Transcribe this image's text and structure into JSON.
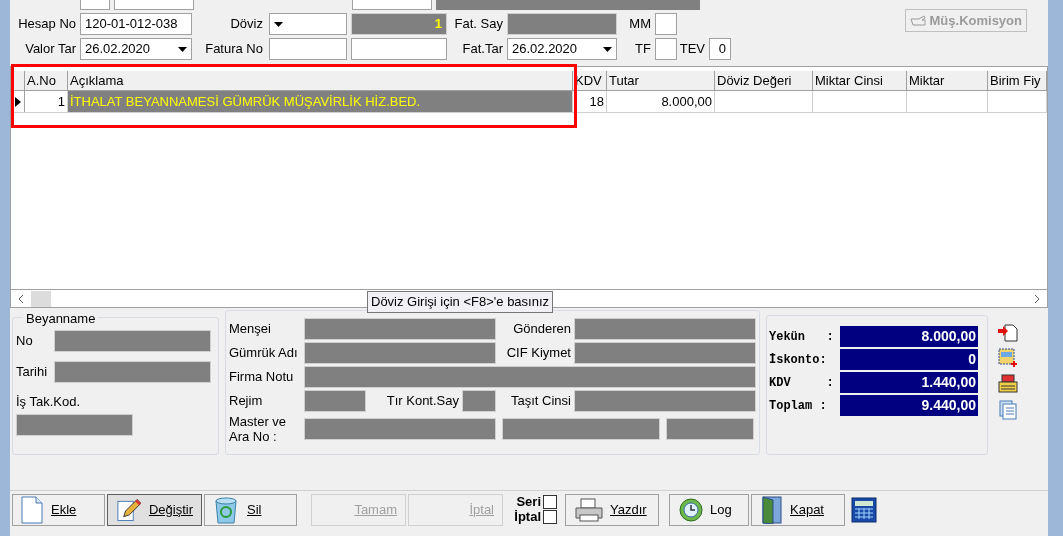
{
  "header": {
    "hesap_no": {
      "label": "Hesap No",
      "value": "120-01-012-038"
    },
    "doviz": {
      "label": "Döviz"
    },
    "doviz_rate": "1",
    "fat_say": {
      "label": "Fat. Say"
    },
    "mm": {
      "label": "MM",
      "checked": false
    },
    "valor_tar": {
      "label": "Valor Tar",
      "value": "26.02.2020"
    },
    "fatura_no": {
      "label": "Fatura No"
    },
    "fat_tar": {
      "label": "Fat.Tar",
      "value": "26.02.2020"
    },
    "tf": {
      "label": "TF",
      "checked": false
    },
    "tev": {
      "label": "TEV",
      "value": "0"
    },
    "komisyon_button": {
      "label": "Müş.Komisyon",
      "disabled": true
    }
  },
  "table": {
    "columns": [
      "A.No",
      "Açıklama",
      "KDV",
      "Tutar",
      "Döviz Değeri",
      "Miktar Cinsi",
      "Miktar",
      "Birim Fiy"
    ],
    "rows": [
      {
        "selected": true,
        "cells": [
          "1",
          "İTHALAT BEYANNAMESİ GÜMRÜK MÜŞAVİRLİK HİZ.BED.",
          "18",
          "8.000,00",
          "",
          "",
          "",
          ""
        ]
      }
    ]
  },
  "tooltip": "Döviz Girişi için <F8>'e basınız",
  "beyanname": {
    "title": "Beyanname",
    "no": "No",
    "tarihi": "Tarihi",
    "is_tak_kod": "İş Tak.Kod."
  },
  "details": {
    "mensei": "Menşei",
    "gonderen": "Gönderen",
    "gumruk_adi": "Gümrük Adı",
    "cif_kiymet": "CIF Kiymet",
    "firma_notu": "Firma Notu",
    "rejim": "Rejim",
    "tir_kont_say": "Tır Kont.Say",
    "tasit_cinsi": "Taşıt Cinsi",
    "master": "Master ve Ara No :"
  },
  "totals": [
    {
      "label": "Yekün   :",
      "value": "8.000,00"
    },
    {
      "label": "İskonto:",
      "value": "0"
    },
    {
      "label": "KDV     :",
      "value": "1.440,00"
    },
    {
      "label": "Toplam :",
      "value": "9.440,00"
    }
  ],
  "toolbar": [
    {
      "label": "Ekle",
      "kind": "add",
      "disabled": false,
      "pressed": false
    },
    {
      "label": "Değiştir",
      "kind": "edit",
      "disabled": false,
      "pressed": true
    },
    {
      "label": "Sil",
      "kind": "delete",
      "disabled": false,
      "pressed": false
    },
    {
      "label": "Tamam",
      "kind": "plain",
      "disabled": true,
      "pressed": false
    },
    {
      "label": "İptal",
      "kind": "plain",
      "disabled": true,
      "pressed": false
    }
  ],
  "seri_iptal": [
    {
      "label": "Seri",
      "checked": false
    },
    {
      "label": "İptal",
      "checked": false
    }
  ],
  "toolbar2": [
    {
      "label": "Yazdır",
      "kind": "print"
    },
    {
      "label": "Log",
      "kind": "log"
    },
    {
      "label": "Kapat",
      "kind": "door"
    }
  ]
}
